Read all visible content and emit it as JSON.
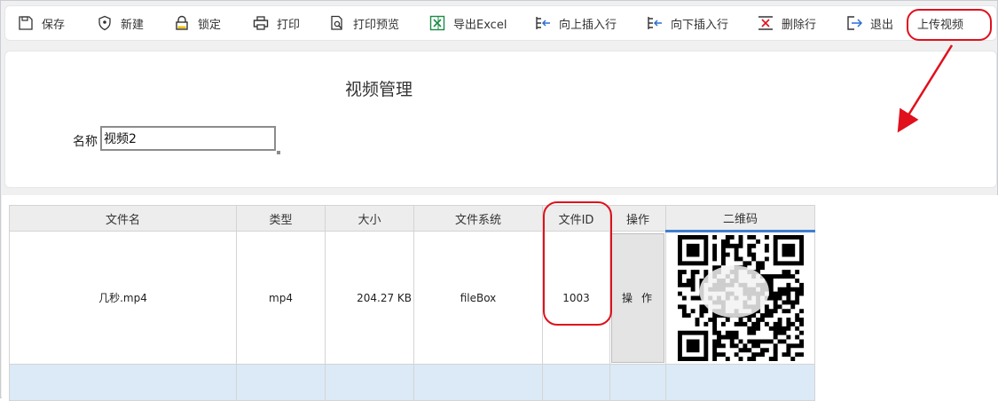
{
  "toolbar": {
    "items": [
      {
        "key": "save",
        "label": "保存",
        "icon": "save-icon"
      },
      {
        "key": "new",
        "label": "新建",
        "icon": "shield-plus-icon"
      },
      {
        "key": "lock",
        "label": "锁定",
        "icon": "lock-icon"
      },
      {
        "key": "print",
        "label": "打印",
        "icon": "printer-icon"
      },
      {
        "key": "preview",
        "label": "打印预览",
        "icon": "print-preview-icon"
      },
      {
        "key": "excel",
        "label": "导出Excel",
        "icon": "excel-icon"
      },
      {
        "key": "insert_up",
        "label": "向上插入行",
        "icon": "insert-row-above-icon"
      },
      {
        "key": "insert_down",
        "label": "向下插入行",
        "icon": "insert-row-below-icon"
      },
      {
        "key": "delete_row",
        "label": "删除行",
        "icon": "delete-row-icon"
      },
      {
        "key": "exit",
        "label": "退出",
        "icon": "exit-icon"
      },
      {
        "key": "upload",
        "label": "上传视频",
        "icon": ""
      }
    ]
  },
  "form": {
    "title": "视频管理",
    "name_label": "名称",
    "name_value": "视频2"
  },
  "grid": {
    "headers": [
      "文件名",
      "类型",
      "大小",
      "文件系统",
      "文件ID",
      "操作",
      "二维码"
    ],
    "rows": [
      {
        "filename": "几秒.mp4",
        "type": "mp4",
        "size": "204.27 KB",
        "filesystem": "fileBox",
        "file_id": "1003",
        "action": "操作"
      }
    ]
  },
  "colors": {
    "accent_border": "#3f7fd0",
    "annotation": "#e0101c",
    "empty_row": "#dbeaf6",
    "excel_green": "#1d8a45"
  }
}
